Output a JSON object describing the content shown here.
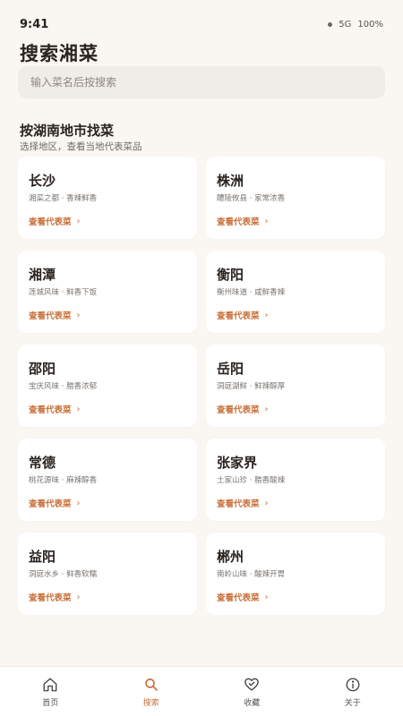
{
  "status_bar": {
    "time": "9:41",
    "network": "5G",
    "battery": "100%"
  },
  "page_title": "搜索湘菜",
  "search": {
    "placeholder": "输入菜名后按搜索",
    "value": ""
  },
  "section": {
    "title": "按湖南地市找菜",
    "subtitle": "选择地区，查看当地代表菜品"
  },
  "regions": [
    {
      "name": "长沙",
      "desc": "湘菜之都 · 香辣鲜香",
      "link": "查看代表菜"
    },
    {
      "name": "株洲",
      "desc": "醴陵攸县 · 家常浓香",
      "link": "查看代表菜"
    },
    {
      "name": "湘潭",
      "desc": "莲城风味 · 鲜香下饭",
      "link": "查看代表菜"
    },
    {
      "name": "衡阳",
      "desc": "衡州味道 · 咸鲜香辣",
      "link": "查看代表菜"
    },
    {
      "name": "邵阳",
      "desc": "宝庆风味 · 腊香浓郁",
      "link": "查看代表菜"
    },
    {
      "name": "岳阳",
      "desc": "洞庭湖鲜 · 鲜辣醇厚",
      "link": "查看代表菜"
    },
    {
      "name": "常德",
      "desc": "桃花源味 · 麻辣醇香",
      "link": "查看代表菜"
    },
    {
      "name": "张家界",
      "desc": "土家山珍 · 腊香酸辣",
      "link": "查看代表菜"
    },
    {
      "name": "益阳",
      "desc": "洞庭水乡 · 鲜香软糯",
      "link": "查看代表菜"
    },
    {
      "name": "郴州",
      "desc": "南岭山味 · 酸辣开胃",
      "link": "查看代表菜"
    }
  ],
  "bottom_nav": {
    "items": [
      {
        "label": "首页",
        "icon": "home-icon"
      },
      {
        "label": "搜索",
        "icon": "search-icon",
        "active": true
      },
      {
        "label": "收藏",
        "icon": "heart-icon"
      },
      {
        "label": "关于",
        "icon": "info-icon"
      }
    ]
  },
  "colors": {
    "accent": "#c8703a",
    "background": "#faf6f2",
    "card": "#ffffff"
  }
}
